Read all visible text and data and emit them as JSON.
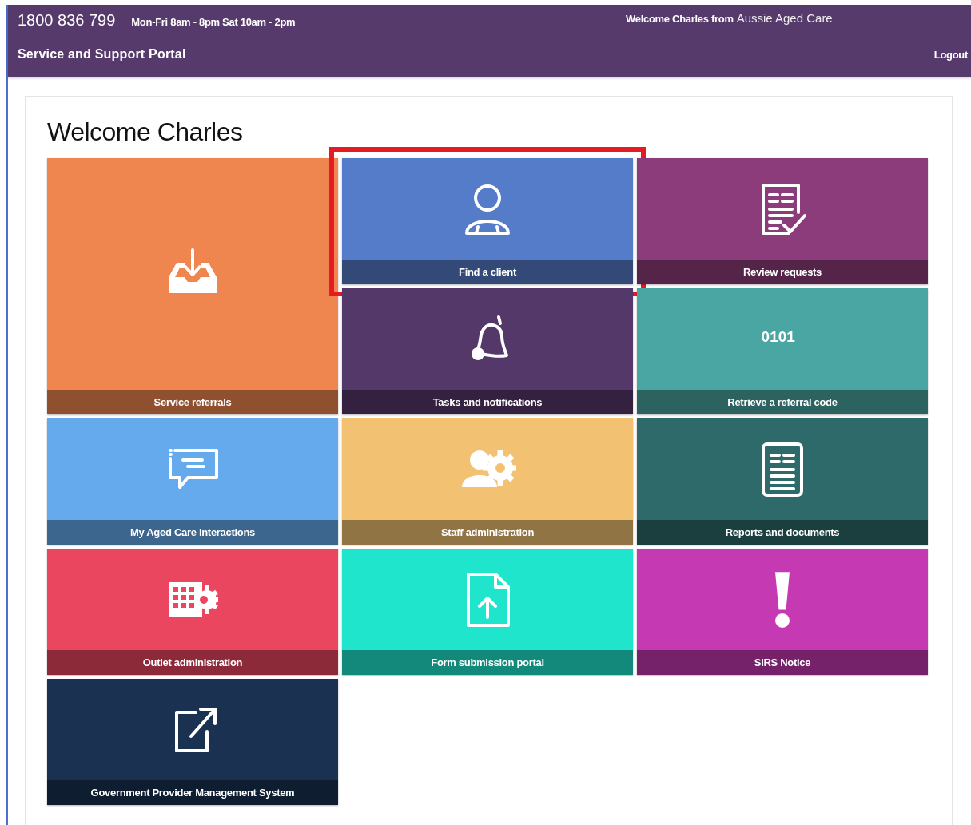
{
  "header": {
    "phone": "1800 836 799",
    "hours": "Mon-Fri 8am - 8pm Sat 10am - 2pm",
    "welcome": "Welcome Charles from",
    "organisation": "Aussie Aged Care",
    "portal_title": "Service and Support Portal",
    "logout": "Logout"
  },
  "heading": "Welcome Charles",
  "tiles": [
    {
      "label": "Service referrals",
      "kind": "inbox",
      "color": "#ef8650",
      "tall": true,
      "highlighted": false
    },
    {
      "label": "Find a client",
      "kind": "person",
      "color": "#557cc8",
      "tall": false,
      "highlighted": true
    },
    {
      "label": "Review requests",
      "kind": "checklist",
      "color": "#8c3c7b",
      "tall": false,
      "highlighted": false
    },
    {
      "label": "Tasks and notifications",
      "kind": "bell",
      "color": "#55386a",
      "tall": false,
      "highlighted": false
    },
    {
      "label": "Retrieve a referral code",
      "kind": "code",
      "code": "0101_",
      "color": "#4aa6a2",
      "tall": false,
      "highlighted": false
    },
    {
      "label": "My Aged Care interactions",
      "kind": "chat",
      "color": "#64aaec",
      "tall": false,
      "highlighted": false
    },
    {
      "label": "Staff administration",
      "kind": "staff",
      "color": "#f2c272",
      "tall": false,
      "highlighted": false
    },
    {
      "label": "Reports and documents",
      "kind": "report",
      "color": "#2e6a69",
      "tall": false,
      "highlighted": false
    },
    {
      "label": "Outlet administration",
      "kind": "outlet",
      "color": "#eb4660",
      "tall": false,
      "highlighted": false
    },
    {
      "label": "Form submission portal",
      "kind": "upload",
      "color": "#1ee5cc",
      "tall": false,
      "highlighted": false
    },
    {
      "label": "SIRS Notice",
      "kind": "alert",
      "color": "#c53ab3",
      "tall": false,
      "highlighted": false
    },
    {
      "label": "Government Provider Management System",
      "kind": "external",
      "color": "#1a3152",
      "tall": false,
      "highlighted": false
    }
  ]
}
